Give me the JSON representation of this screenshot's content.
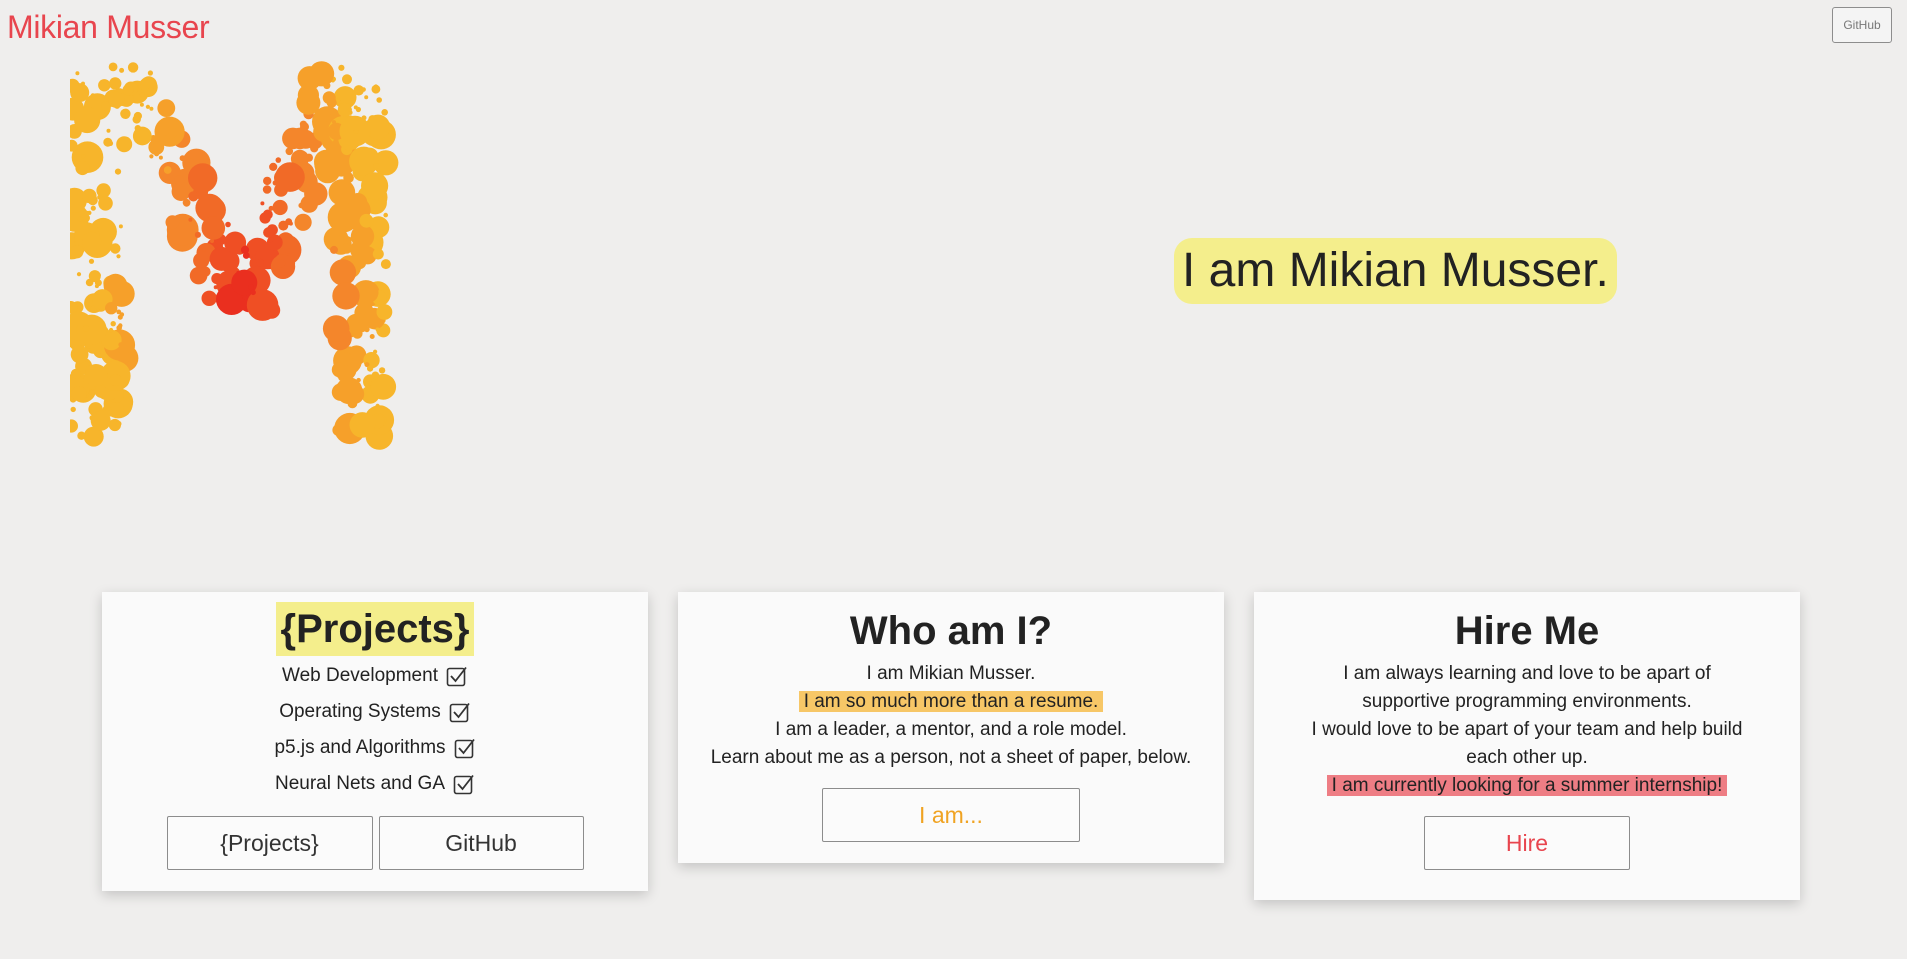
{
  "header": {
    "brand": "Mikian Musser",
    "github_button": "GitHub"
  },
  "hero": {
    "intro": "I am Mikian Musser."
  },
  "cards": {
    "projects": {
      "title": "{Projects}",
      "items": [
        {
          "label": "Web Development",
          "checked": true
        },
        {
          "label": "Operating Systems",
          "checked": true
        },
        {
          "label": "p5.js and Algorithms",
          "checked": true
        },
        {
          "label": "Neural Nets and GA",
          "checked": true
        }
      ],
      "projects_button": "{Projects}",
      "github_button": "GitHub"
    },
    "who": {
      "title": "Who am I?",
      "line1": "I am Mikian Musser.",
      "line2": "I am so much more than a resume.",
      "line3": "I am a leader, a mentor, and a role model.",
      "line4": "Learn about me as a person, not a sheet of paper, below.",
      "button": "I am..."
    },
    "hire": {
      "title": "Hire Me",
      "line1": "I am always learning and love to be apart of supportive programming environments.",
      "line2": "I would love to be apart of your team and help build each other up.",
      "line3": "I am currently looking for a summer internship!",
      "button": "Hire"
    }
  },
  "colors": {
    "brand": "#e8454e",
    "intro_highlight": "#f4ee8c",
    "projects_highlight": "#f4ee8c",
    "resume_highlight": "#f7c767",
    "internship_highlight": "#ee7d84",
    "who_button_text": "#f0a322",
    "hire_button_text": "#e8454e"
  },
  "icons": {
    "checkbox": "checked-box-icon"
  }
}
